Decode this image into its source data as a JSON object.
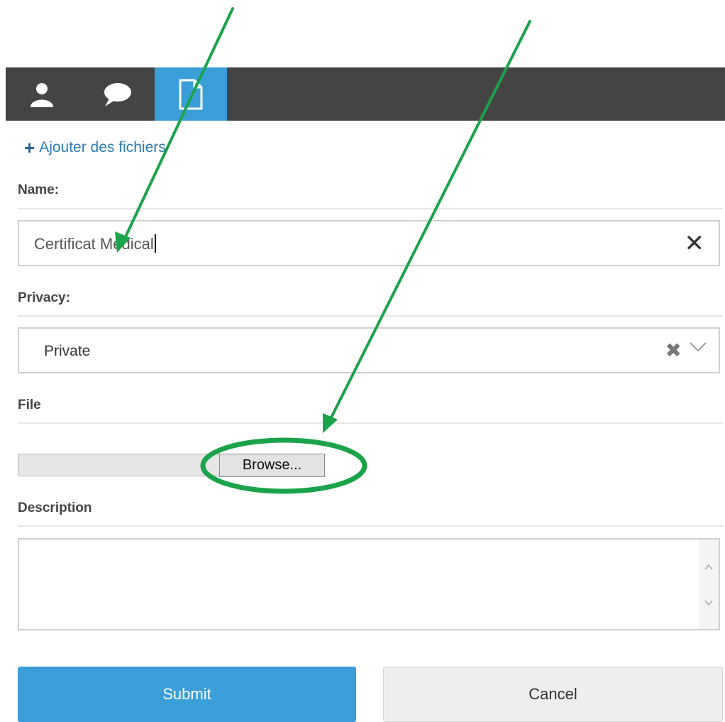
{
  "tabs": [
    {
      "icon": "user-icon",
      "active": false
    },
    {
      "icon": "comment-icon",
      "active": false
    },
    {
      "icon": "file-icon",
      "active": true
    }
  ],
  "add_files_link": "Ajouter des fichiers",
  "name": {
    "label": "Name:",
    "value": "Certificat Medical",
    "clear_icon": "close-icon"
  },
  "privacy": {
    "label": "Privacy:",
    "value": "Private",
    "clear_icon": "close-icon",
    "dropdown_icon": "chevron-down-icon"
  },
  "file": {
    "label": "File",
    "browse_label": "Browse..."
  },
  "description": {
    "label": "Description",
    "value": ""
  },
  "actions": {
    "submit_label": "Submit",
    "cancel_label": "Cancel"
  },
  "colors": {
    "accent": "#3a9fd8",
    "tabbar": "#444444",
    "link": "#2b7bb9",
    "annotation": "#1aa34a"
  }
}
